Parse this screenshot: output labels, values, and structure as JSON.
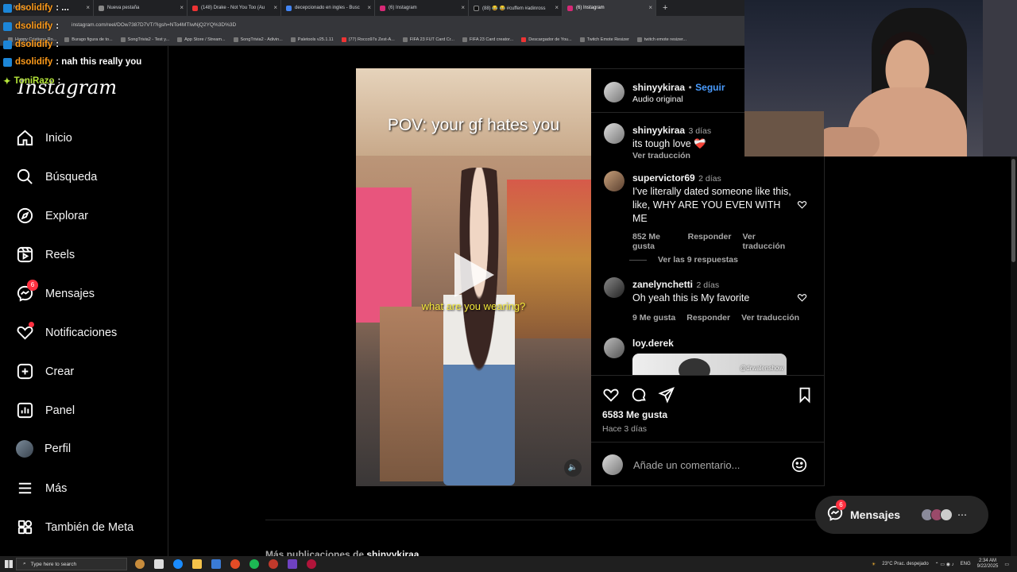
{
  "browser": {
    "tabs": [
      {
        "label": "Nuevo",
        "active": false
      },
      {
        "label": "Nueva pestaña",
        "active": false
      },
      {
        "label": "(148) Drake - Not You Too (Au",
        "active": false
      },
      {
        "label": "decepcionado en ingles - Busc",
        "active": false
      },
      {
        "label": "(6) Instagram",
        "active": false
      },
      {
        "label": "(88) 😂 😂 #cuffem #adinross",
        "active": false
      },
      {
        "label": "(6) Instagram",
        "active": true
      }
    ],
    "new_tab": "+",
    "url": "instagram.com/reel/DOw7387D7VT/?igsh=NTo4MTIwNjQ2YQ%3D%3D",
    "bookmarks": [
      "Happy Cristiano Ro...",
      "Burago figura de to...",
      "SongTrivia2 - Test y...",
      "App Store / Stream...",
      "SongTrivia2 - Adivin...",
      "Paletools v25.1.11",
      "(77) Rocco97s Zest-A...",
      "FIFA 23 FUT Card Cr...",
      "FIFA 23 Card creator...",
      "Descargador de You...",
      "Twitch Emote Resizer",
      "twitch emote resizer..."
    ]
  },
  "chat": [
    {
      "user": "dsolidify",
      "text": ": ..."
    },
    {
      "user": "dsolidify",
      "text": ":"
    },
    {
      "user": "dsolidify",
      "text": ":"
    },
    {
      "user": "dsolidify",
      "text": ": nah this really you"
    },
    {
      "user": "ToniRazo",
      "text": ":"
    }
  ],
  "sidebar": {
    "logo": "Instagram",
    "items": [
      {
        "label": "Inicio"
      },
      {
        "label": "Búsqueda"
      },
      {
        "label": "Explorar"
      },
      {
        "label": "Reels"
      },
      {
        "label": "Mensajes",
        "badge": "6"
      },
      {
        "label": "Notificaciones"
      },
      {
        "label": "Crear"
      },
      {
        "label": "Panel"
      },
      {
        "label": "Perfil"
      },
      {
        "label": "Más"
      },
      {
        "label": "También de Meta"
      }
    ]
  },
  "video": {
    "overlay_title": "POV: your gf hates you",
    "caption": "what are you wearing?",
    "mute_icon": "speaker-icon"
  },
  "post": {
    "author": "shinyykiraa",
    "follow": "Seguir",
    "audio": "Audio original",
    "author_comment": {
      "user": "shinyykiraa",
      "time": "3 días",
      "text": "its tough love ❤️‍🩹",
      "translate": "Ver traducción"
    },
    "comments": [
      {
        "user": "supervictor69",
        "time": "2 días",
        "text": "I've literally dated someone like this, like, WHY ARE YOU EVEN WITH ME",
        "likes": "852 Me gusta",
        "reply": "Responder",
        "translate": "Ver traducción",
        "replies": "Ver las 9 respuestas"
      },
      {
        "user": "zanelynchetti",
        "time": "2 días",
        "text": "Oh yeah this is My favorite",
        "likes": "9 Me gusta",
        "reply": "Responder",
        "translate": "Ver traducción"
      },
      {
        "user": "loy.derek",
        "image_tag": "@drwalenshow"
      }
    ],
    "like_count": "6583 Me gusta",
    "posted": "Hace 3 días",
    "add_comment_placeholder": "Añade un comentario..."
  },
  "more_posts": {
    "prefix": "Más publicaciones de ",
    "user": "shinyykiraa"
  },
  "messages_pill": {
    "label": "Mensajes",
    "badge": "6"
  },
  "taskbar": {
    "search_placeholder": "Type here to search",
    "weather": "23°C  Prac. despejado",
    "lang": "ENG",
    "time": "2:34 AM",
    "date": "9/22/2025"
  }
}
